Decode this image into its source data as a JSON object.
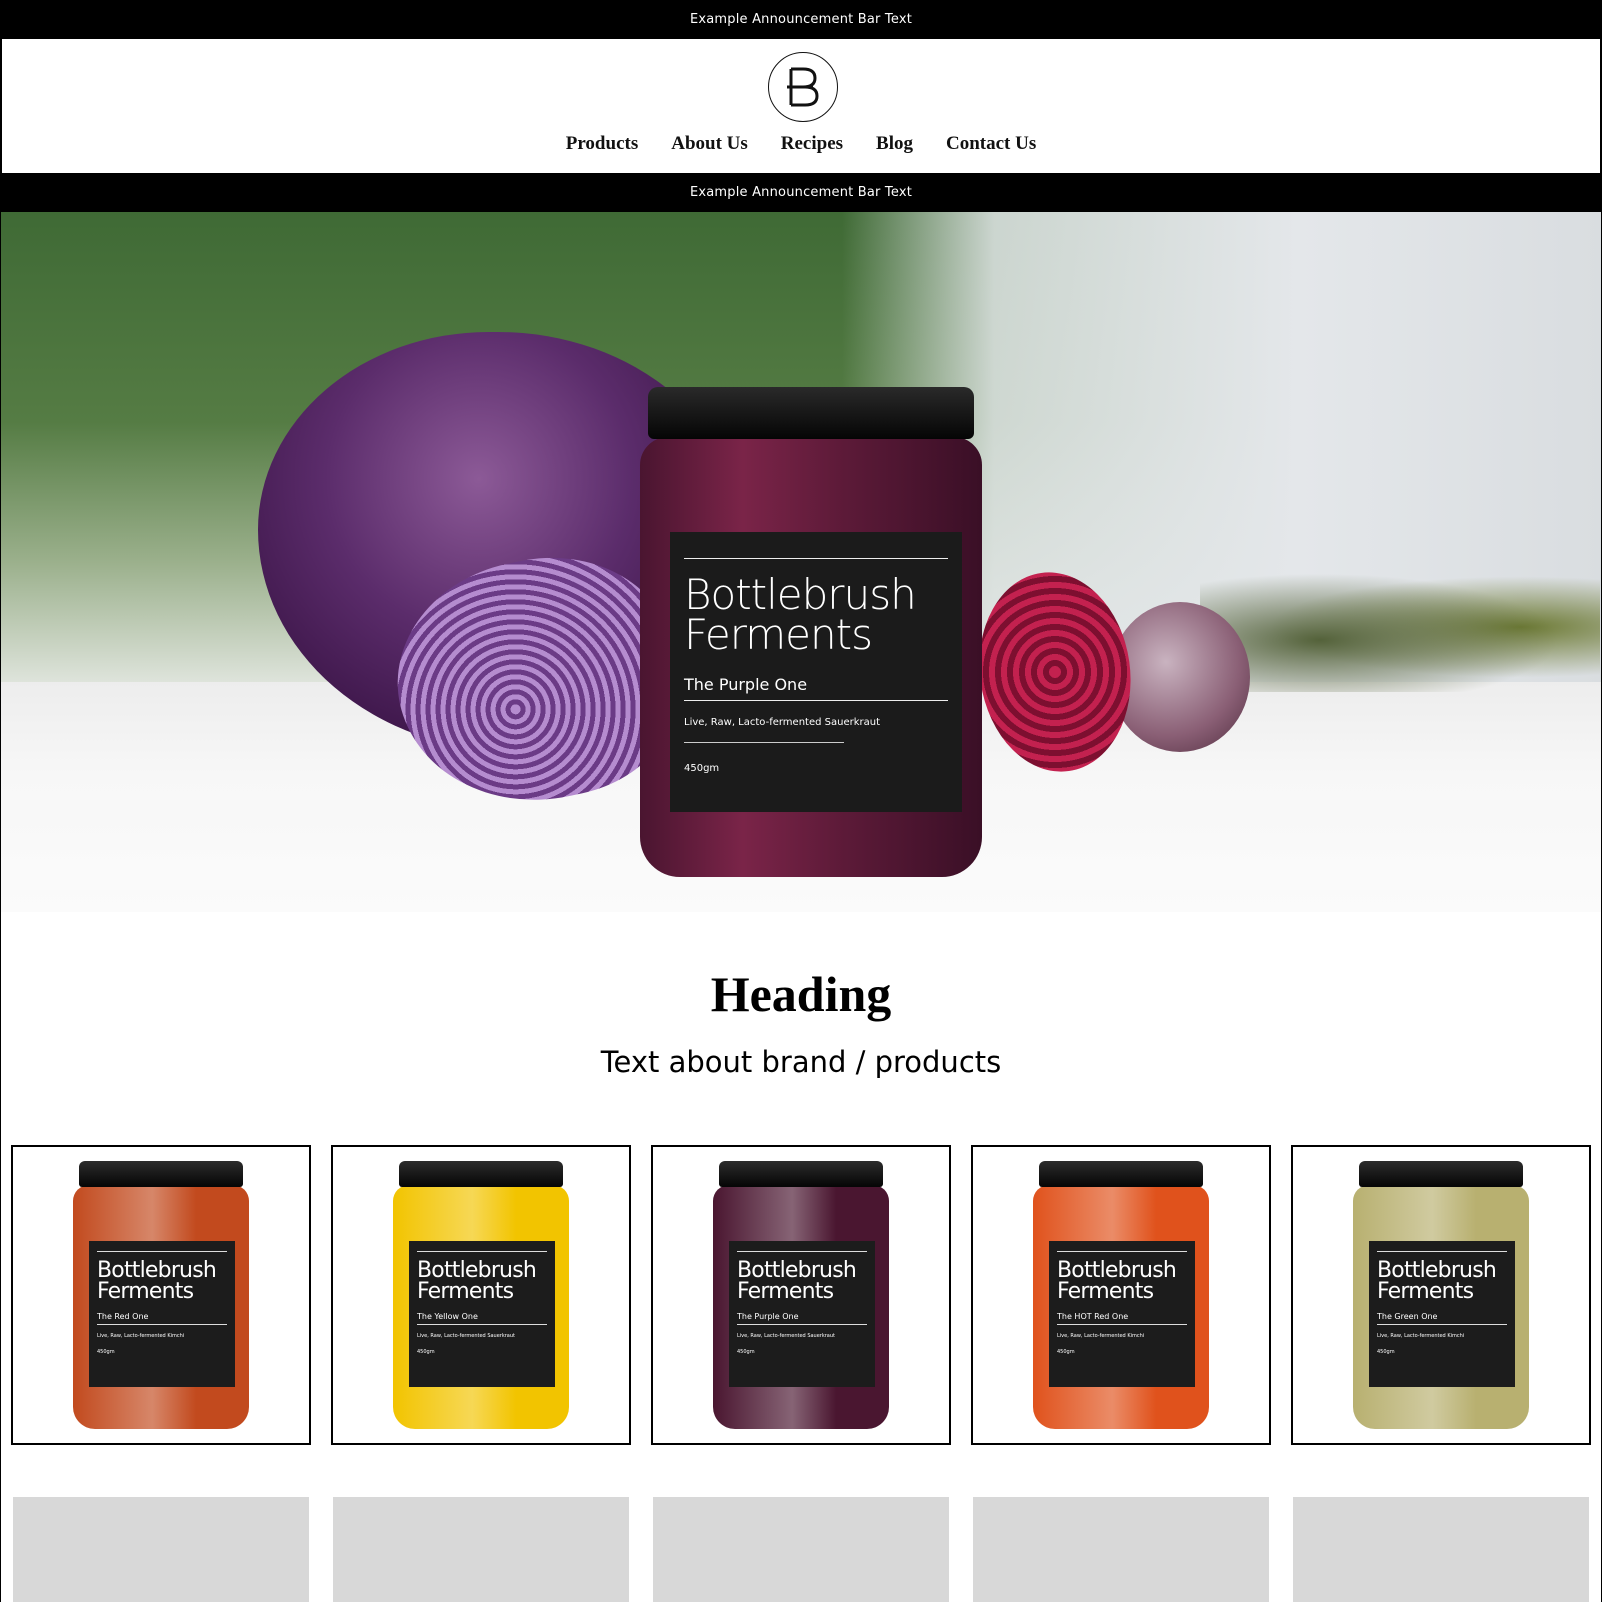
{
  "announcement_top": "Example Announcement Bar Text",
  "announcement_mid": "Example Announcement Bar Text",
  "logo": {
    "icon": "bottlebrush-b-logo-icon"
  },
  "nav": {
    "items": [
      {
        "label": "Products"
      },
      {
        "label": "About Us"
      },
      {
        "label": "Recipes"
      },
      {
        "label": "Blog"
      },
      {
        "label": "Contact Us"
      }
    ]
  },
  "hero": {
    "jar": {
      "brand_line1": "Bottlebrush",
      "brand_line2": "Ferments",
      "name": "The Purple One",
      "description": "Live, Raw, Lacto-fermented Sauerkraut",
      "weight": "450gm"
    }
  },
  "section": {
    "heading": "Heading",
    "subtext": "Text about brand / products"
  },
  "products": [
    {
      "brand_line1": "Bottlebrush",
      "brand_line2": "Ferments",
      "name": "The Red One",
      "description": "Live, Raw, Lacto-fermented Kimchi",
      "weight": "450gm",
      "color": "#c24a1e"
    },
    {
      "brand_line1": "Bottlebrush",
      "brand_line2": "Ferments",
      "name": "The Yellow One",
      "description": "Live, Raw, Lacto-fermented Sauerkraut",
      "weight": "450gm",
      "color": "#f2c400"
    },
    {
      "brand_line1": "Bottlebrush",
      "brand_line2": "Ferments",
      "name": "The Purple One",
      "description": "Live, Raw, Lacto-fermented Sauerkraut",
      "weight": "450gm",
      "color": "#4a1630"
    },
    {
      "brand_line1": "Bottlebrush",
      "brand_line2": "Ferments",
      "name": "The HOT Red One",
      "description": "Live, Raw, Lacto-fermented Kimchi",
      "weight": "450gm",
      "color": "#e0521c"
    },
    {
      "brand_line1": "Bottlebrush",
      "brand_line2": "Ferments",
      "name": "The Green One",
      "description": "Live, Raw, Lacto-fermented Kimchi",
      "weight": "450gm",
      "color": "#b8b070"
    }
  ],
  "colors": {
    "announcement_bg": "#000000",
    "placeholder": "#d8d8d8"
  }
}
